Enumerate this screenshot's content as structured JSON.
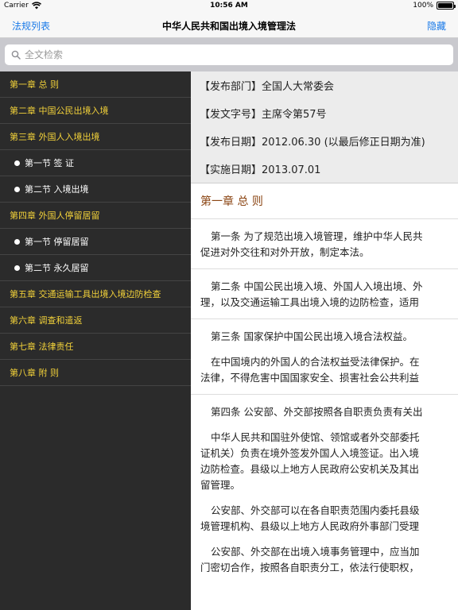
{
  "status": {
    "carrier": "Carrier",
    "time": "10:56 AM",
    "battery": "100%"
  },
  "nav": {
    "back_label": "法规列表",
    "title": "中华人民共和国出境入境管理法",
    "hide_label": "隐藏"
  },
  "search": {
    "placeholder": "全文检索"
  },
  "toc": [
    {
      "label": "第一章 总 则",
      "level": 0
    },
    {
      "label": "第二章 中国公民出境入境",
      "level": 0
    },
    {
      "label": "第三章 外国人入境出境",
      "level": 0
    },
    {
      "label": "第一节 签 证",
      "level": 1
    },
    {
      "label": "第二节 入境出境",
      "level": 1
    },
    {
      "label": "第四章 外国人停留居留",
      "level": 0
    },
    {
      "label": "第一节 停留居留",
      "level": 1
    },
    {
      "label": "第二节 永久居留",
      "level": 1
    },
    {
      "label": "第五章 交通运输工具出境入境边防检查",
      "level": 0
    },
    {
      "label": "第六章 调查和遣返",
      "level": 0
    },
    {
      "label": "第七章 法律责任",
      "level": 0
    },
    {
      "label": "第八章 附 则",
      "level": 0
    }
  ],
  "meta": {
    "issuer": "【发布部门】全国人大常委会",
    "doc_no": "【发文字号】主席令第57号",
    "issue_date": "【发布日期】2012.06.30 (以最后修正日期为准)",
    "effective_date": "【实施日期】2013.07.01"
  },
  "content": {
    "chapter_title": "第一章 总 则",
    "art1": [
      "第一条 为了规范出境入境管理，维护中华人民共",
      "促进对外交往和对外开放，制定本法。"
    ],
    "art2": [
      "第二条 中国公民出境入境、外国人入境出境、外",
      "理，以及交通运输工具出境入境的边防检查，适用"
    ],
    "art3_p1": "第三条 国家保护中国公民出境入境合法权益。",
    "art3_p2": [
      "在中国境内的外国人的合法权益受法律保护。在",
      "法律，不得危害中国国家安全、损害社会公共利益"
    ],
    "art4_p1": "第四条 公安部、外交部按照各自职责负责有关出",
    "art4_p2": [
      "中华人民共和国驻外使馆、领馆或者外交部委托",
      "证机关）负责在境外签发外国人入境签证。出入境",
      "边防检查。县级以上地方人民政府公安机关及其出",
      "留管理。"
    ],
    "art4_p3": [
      "公安部、外交部可以在各自职责范围内委托县级",
      "境管理机构、县级以上地方人民政府外事部门受理"
    ],
    "art4_p4": [
      "公安部、外交部在出境入境事务管理中，应当加",
      "门密切合作，按照各自职责分工，依法行使职权，"
    ]
  }
}
